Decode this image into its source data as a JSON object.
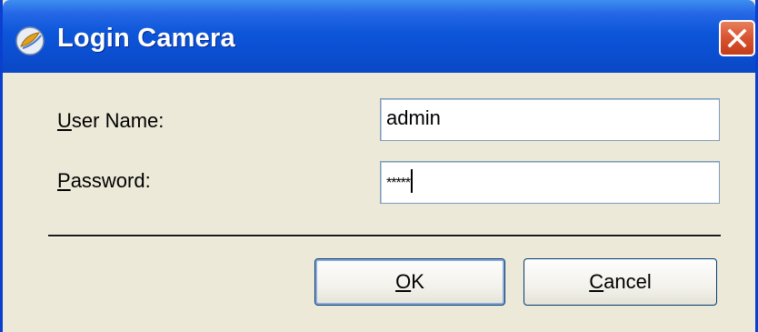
{
  "window": {
    "title": "Login Camera",
    "icon": "camera-app-icon",
    "close_icon": "close-icon",
    "titlebar_color": "#0b4fd2",
    "close_color": "#d8532f",
    "dialog_bg": "#ece9d8"
  },
  "form": {
    "username": {
      "label_mnemonic": "U",
      "label_rest": "ser Name:",
      "value": "admin"
    },
    "password": {
      "label_mnemonic": "P",
      "label_rest": "assword:",
      "value_masked": "*****"
    }
  },
  "buttons": {
    "ok": {
      "mnemonic": "O",
      "rest": "K"
    },
    "cancel": {
      "mnemonic": "C",
      "rest": "ancel"
    }
  }
}
